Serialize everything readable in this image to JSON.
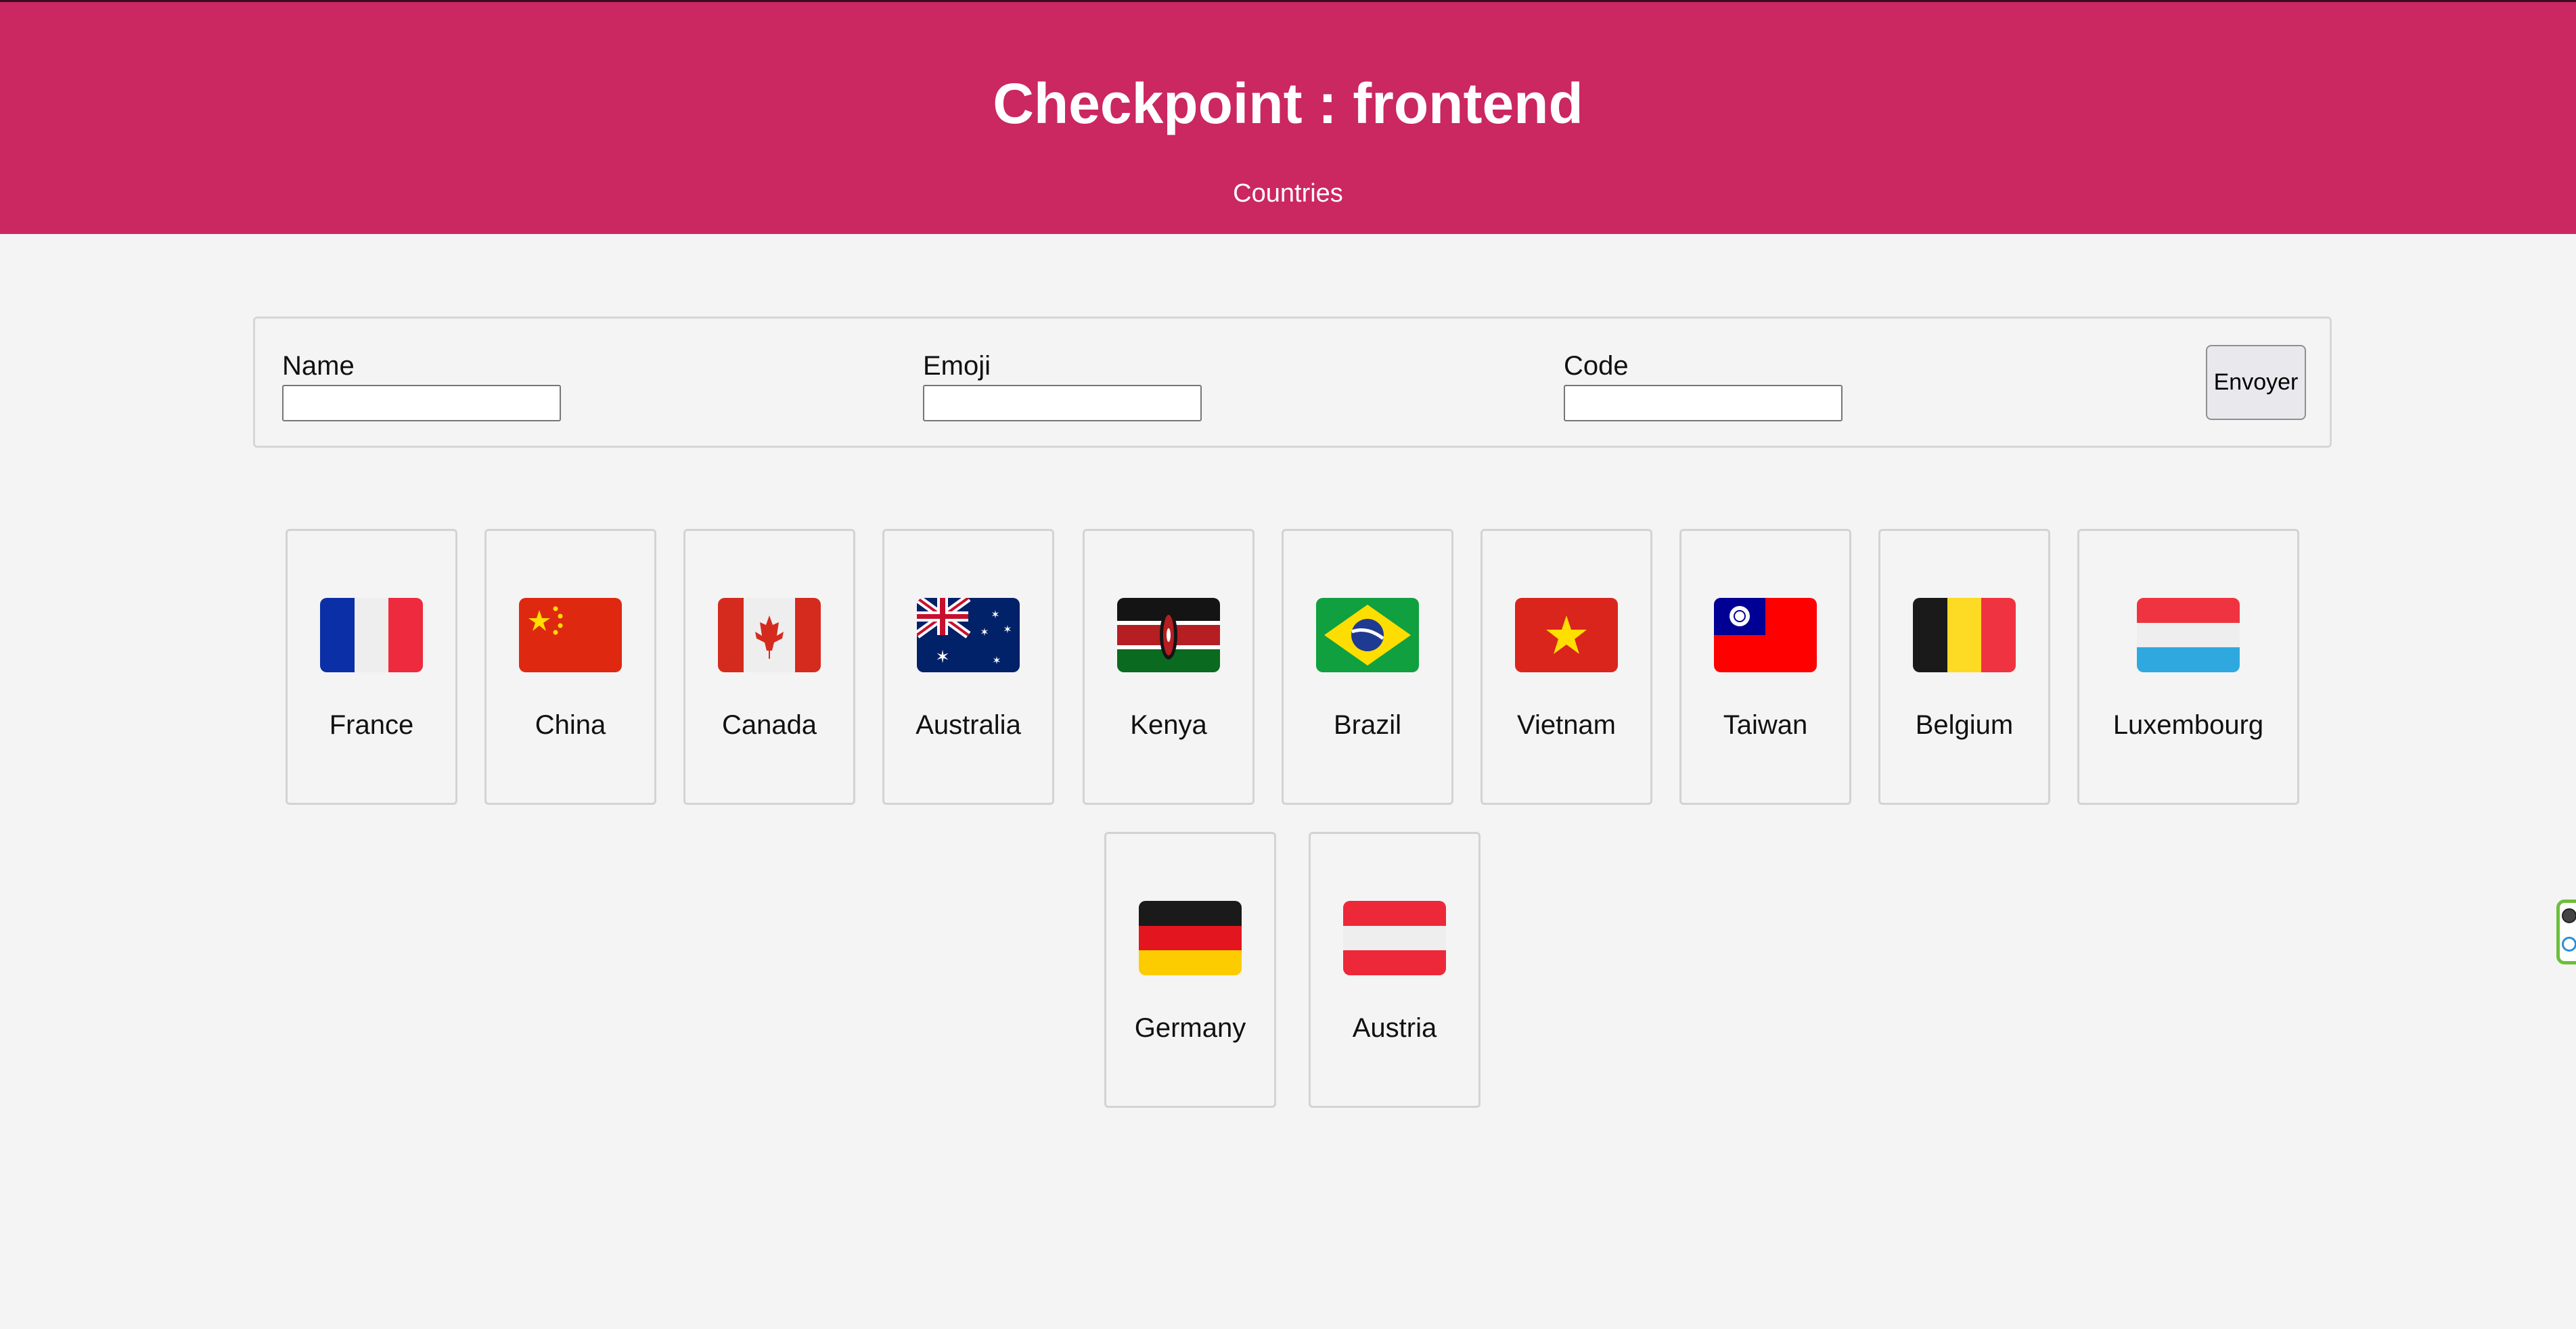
{
  "header": {
    "title": "Checkpoint : frontend",
    "subtitle": "Countries"
  },
  "form": {
    "fields": [
      {
        "label": "Name",
        "value": ""
      },
      {
        "label": "Emoji",
        "value": ""
      },
      {
        "label": "Code",
        "value": ""
      }
    ],
    "submit_label": "Envoyer"
  },
  "countries": [
    {
      "name": "France",
      "flag": "flag-france-icon"
    },
    {
      "name": "China",
      "flag": "flag-china-icon"
    },
    {
      "name": "Canada",
      "flag": "flag-canada-icon"
    },
    {
      "name": "Australia",
      "flag": "flag-australia-icon"
    },
    {
      "name": "Kenya",
      "flag": "flag-kenya-icon"
    },
    {
      "name": "Brazil",
      "flag": "flag-brazil-icon"
    },
    {
      "name": "Vietnam",
      "flag": "flag-vietnam-icon"
    },
    {
      "name": "Taiwan",
      "flag": "flag-taiwan-icon"
    },
    {
      "name": "Belgium",
      "flag": "flag-belgium-icon"
    },
    {
      "name": "Luxembourg",
      "flag": "flag-luxembourg-icon"
    },
    {
      "name": "Germany",
      "flag": "flag-germany-icon"
    },
    {
      "name": "Austria",
      "flag": "flag-austria-icon"
    }
  ],
  "colors": {
    "header_bg": "#cb2761",
    "page_bg": "#f4f4f4",
    "card_border": "#d3d3d3"
  }
}
